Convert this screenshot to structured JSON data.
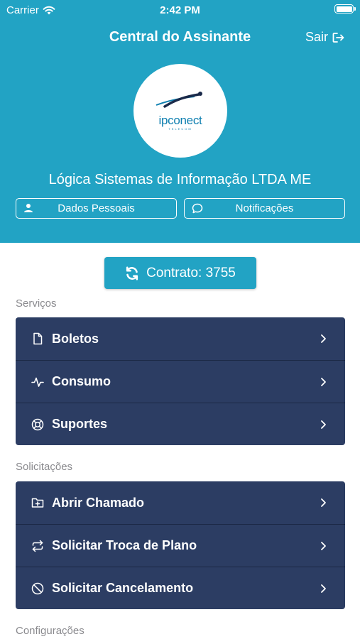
{
  "status_bar": {
    "carrier": "Carrier",
    "time": "2:42 PM"
  },
  "header": {
    "title": "Central do Assinante",
    "logout_label": "Sair",
    "logo_text": "ipconect",
    "logo_subtext": "TELECOM",
    "company_name": "Lógica Sistemas de Informação LTDA ME",
    "personal_data_label": "Dados Pessoais",
    "notifications_label": "Notificações"
  },
  "contract": {
    "label": "Contrato: 3755"
  },
  "sections": {
    "services": {
      "label": "Serviços",
      "items": [
        {
          "label": "Boletos",
          "icon": "document-icon"
        },
        {
          "label": "Consumo",
          "icon": "activity-icon"
        },
        {
          "label": "Suportes",
          "icon": "lifebuoy-icon"
        }
      ]
    },
    "requests": {
      "label": "Solicitações",
      "items": [
        {
          "label": "Abrir Chamado",
          "icon": "folder-plus-icon"
        },
        {
          "label": "Solicitar Troca de Plano",
          "icon": "repeat-icon"
        },
        {
          "label": "Solicitar Cancelamento",
          "icon": "block-icon"
        }
      ]
    },
    "settings": {
      "label": "Configurações"
    }
  },
  "colors": {
    "header_bg": "#22a3c4",
    "menu_bg": "#2c3d63",
    "section_label": "#8a8a8e"
  }
}
